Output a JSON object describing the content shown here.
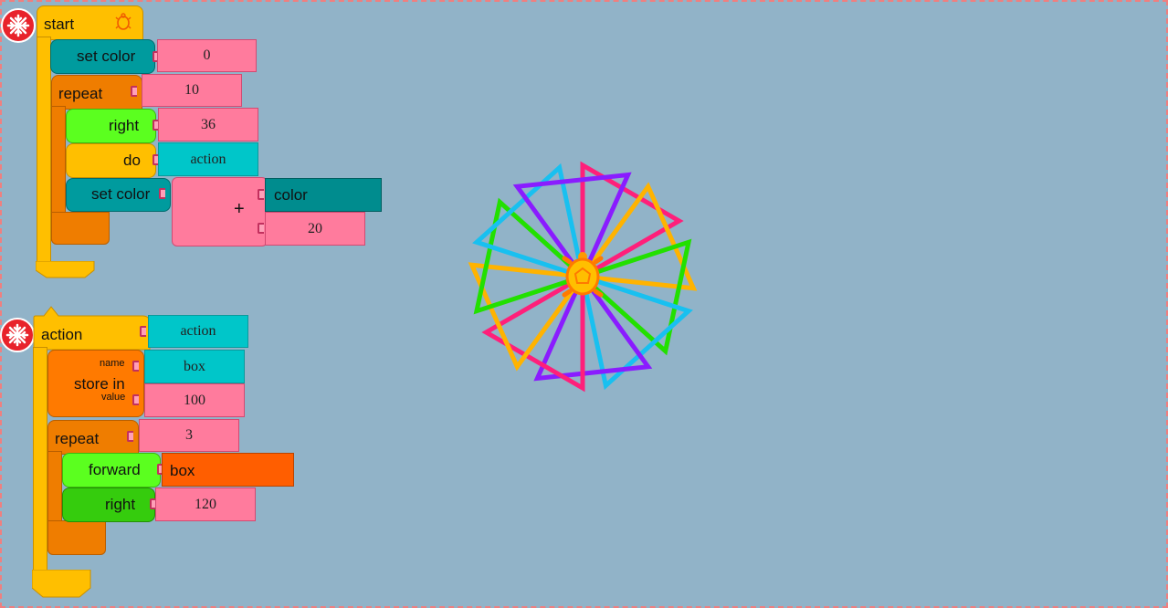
{
  "start_stack": {
    "hat_label": "start",
    "set_color_label": "set color",
    "set_color_value": "0",
    "repeat_label": "repeat",
    "repeat_count": "10",
    "right_label": "right",
    "right_value": "36",
    "do_label": "do",
    "do_value": "action",
    "set_color2_label": "set color",
    "plus_label": "+",
    "color_label": "color",
    "add_value": "20"
  },
  "action_stack": {
    "hat_label": "action",
    "hat_name": "action",
    "store_label": "store in",
    "store_name_label": "name",
    "store_value_label": "value",
    "store_name": "box",
    "store_value": "100",
    "repeat_label": "repeat",
    "repeat_count": "3",
    "forward_label": "forward",
    "forward_value": "box",
    "right_label": "right",
    "right_value": "120"
  },
  "colors": {
    "background": "#91b3c8",
    "pen_palette": [
      "#ff1f7a",
      "#ffb300",
      "#22e000",
      "#18c0f0",
      "#8a1cff"
    ]
  },
  "icons": {
    "start_hat": "turtle-icon",
    "collapse_buttons": "stop-sign-icon",
    "canvas_turtle": "turtle-icon"
  }
}
